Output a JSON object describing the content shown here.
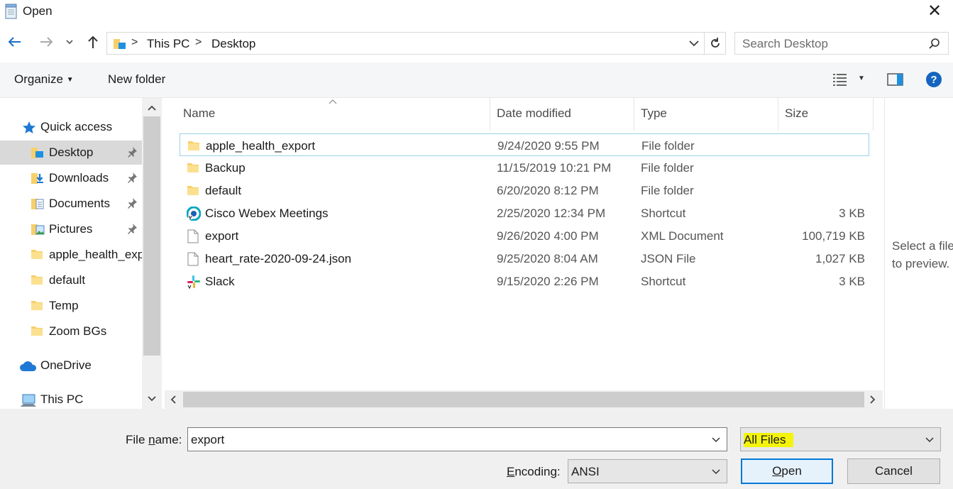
{
  "window": {
    "title": "Open",
    "close_glyph": "✕"
  },
  "address": {
    "segments": [
      "This PC",
      "Desktop"
    ],
    "separator": ">"
  },
  "search": {
    "placeholder": "Search Desktop"
  },
  "toolbar": {
    "organize": "Organize",
    "new_folder": "New folder"
  },
  "nav": {
    "quick_access": "Quick access",
    "items": [
      {
        "label": "Desktop",
        "pinned": true,
        "icon": "desktop-folder-icon"
      },
      {
        "label": "Downloads",
        "pinned": true,
        "icon": "downloads-folder-icon"
      },
      {
        "label": "Documents",
        "pinned": true,
        "icon": "documents-folder-icon"
      },
      {
        "label": "Pictures",
        "pinned": true,
        "icon": "pictures-folder-icon"
      },
      {
        "label": "apple_health_export",
        "pinned": false,
        "icon": "folder-icon"
      },
      {
        "label": "default",
        "pinned": false,
        "icon": "folder-icon"
      },
      {
        "label": "Temp",
        "pinned": false,
        "icon": "folder-icon"
      },
      {
        "label": "Zoom BGs",
        "pinned": false,
        "icon": "folder-icon"
      }
    ],
    "onedrive": "OneDrive",
    "this_pc": "This PC"
  },
  "columns": {
    "name": "Name",
    "date": "Date modified",
    "type": "Type",
    "size": "Size"
  },
  "files": [
    {
      "name": "apple_health_export",
      "date": "9/24/2020 9:55 PM",
      "type": "File folder",
      "size": "",
      "icon": "folder-icon"
    },
    {
      "name": "Backup",
      "date": "11/15/2019 10:21 PM",
      "type": "File folder",
      "size": "",
      "icon": "folder-icon"
    },
    {
      "name": "default",
      "date": "6/20/2020 8:12 PM",
      "type": "File folder",
      "size": "",
      "icon": "folder-icon"
    },
    {
      "name": "Cisco Webex Meetings",
      "date": "2/25/2020 12:34 PM",
      "type": "Shortcut",
      "size": "3 KB",
      "icon": "webex-icon"
    },
    {
      "name": "export",
      "date": "9/26/2020 4:00 PM",
      "type": "XML Document",
      "size": "100,719 KB",
      "icon": "file-icon"
    },
    {
      "name": "heart_rate-2020-09-24.json",
      "date": "9/25/2020 8:04 AM",
      "type": "JSON File",
      "size": "1,027 KB",
      "icon": "file-icon"
    },
    {
      "name": "Slack",
      "date": "9/15/2020 2:26 PM",
      "type": "Shortcut",
      "size": "3 KB",
      "icon": "slack-icon"
    }
  ],
  "preview": {
    "line1": "Select a file",
    "line2": "to preview."
  },
  "bottom": {
    "filename_label_pre": "File ",
    "filename_label_u": "n",
    "filename_label_post": "ame:",
    "filename_value": "export",
    "filetype_value": "All Files",
    "encoding_label_pre": "",
    "encoding_label_u": "E",
    "encoding_label_post": "ncoding:",
    "encoding_value": "ANSI",
    "open_label_u": "O",
    "open_label_post": "pen",
    "cancel_label": "Cancel"
  },
  "colors": {
    "accent": "#0078d7",
    "highlight": "#f4f40a",
    "folder": "#f8d06a"
  }
}
